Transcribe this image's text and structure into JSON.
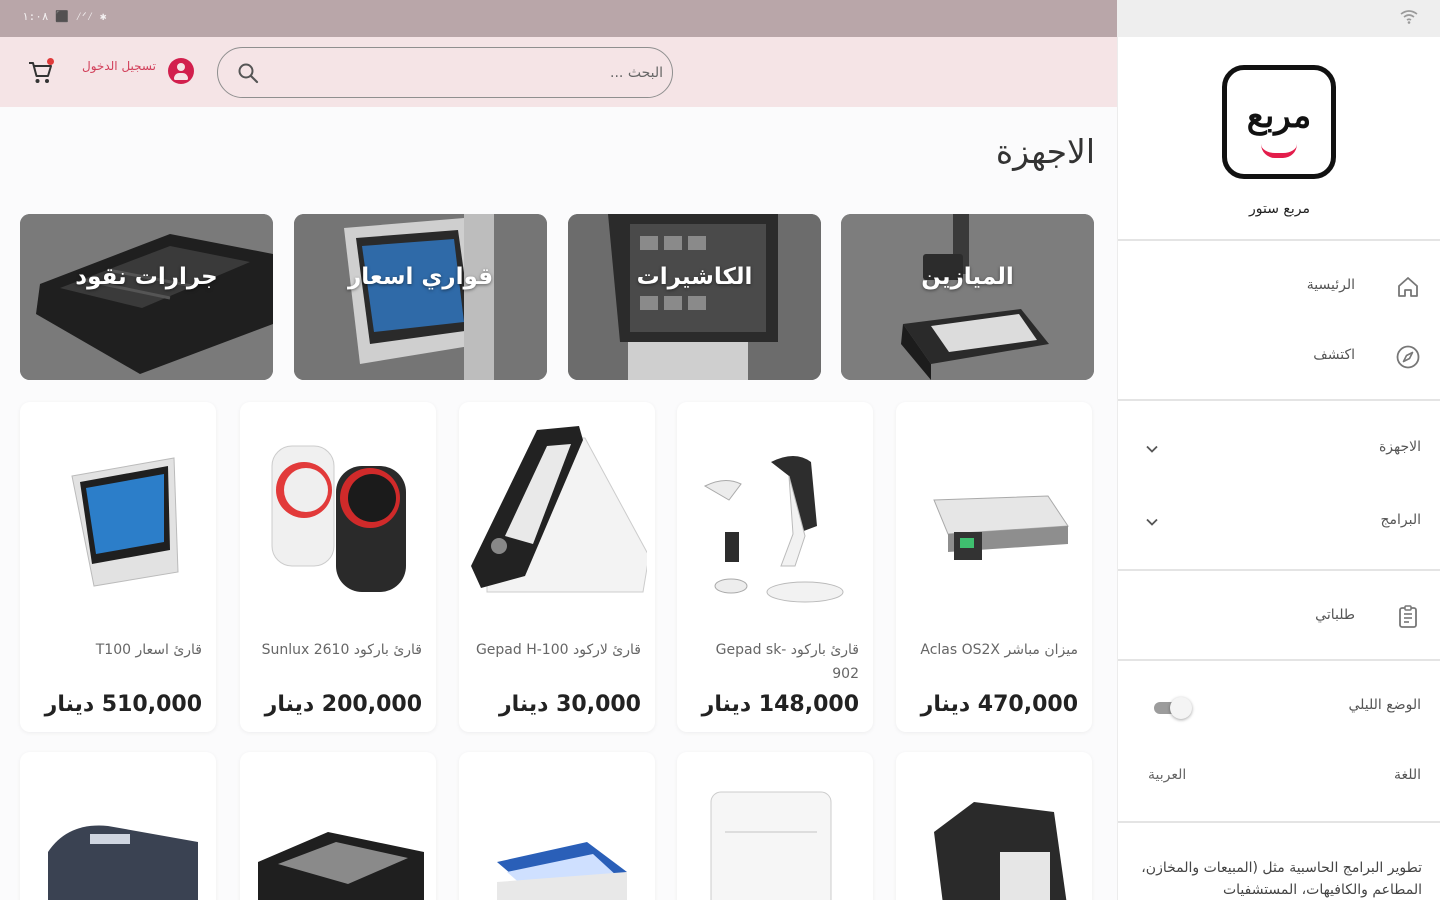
{
  "status_bar": {
    "left": "۱:۰۸ ⬛ ⁄ᐟ⁄ ✱",
    "right_icon": "wifi-icon"
  },
  "header": {
    "search_placeholder": "البحث ...",
    "login_label": "تسجيل الدخول",
    "cart_icon": "cart-icon",
    "account_icon": "account-icon",
    "search_icon": "search-icon"
  },
  "sidebar": {
    "logo_text": "مربع",
    "store_name": "مربع ستور",
    "nav": [
      {
        "label": "الرئيسية",
        "icon": "home-icon"
      },
      {
        "label": "اكتشف",
        "icon": "compass-icon"
      }
    ],
    "groups": [
      {
        "label": "الاجهزة"
      },
      {
        "label": "البرامج"
      }
    ],
    "orders": {
      "label": "طلباتي",
      "icon": "orders-icon"
    },
    "dark_mode": {
      "label": "الوضع الليلي",
      "enabled": false
    },
    "language": {
      "label": "اللغة",
      "value": "العربية"
    },
    "about": "تطوير البرامج الحاسبية مثل (المبيعات والمخازن، المطاعم والكافيهات، المستشفيات"
  },
  "main": {
    "section_title": "الاجهزة",
    "categories": [
      {
        "label": "الميازين"
      },
      {
        "label": "الكاشيرات"
      },
      {
        "label": "قواري اسعار"
      },
      {
        "label": "جرارات نقود"
      }
    ],
    "products": [
      {
        "name": "ميزان مباشر Aclas OS2X",
        "price": "470,000 دينار"
      },
      {
        "name": "قارئ باركود Gepad sk-902",
        "price": "148,000 دينار"
      },
      {
        "name": "قارئ لاركود Gepad H-100",
        "price": "30,000 دينار"
      },
      {
        "name": "قارئ باركود Sunlux 2610",
        "price": "200,000 دينار"
      },
      {
        "name": "قارئ اسعار T100",
        "price": "510,000 دينار"
      }
    ]
  },
  "colors": {
    "accent": "#d21f4d",
    "header_bg": "#f5e4e6",
    "status_bg": "#b9a6a9",
    "logo_smile": "#e31d4b"
  }
}
